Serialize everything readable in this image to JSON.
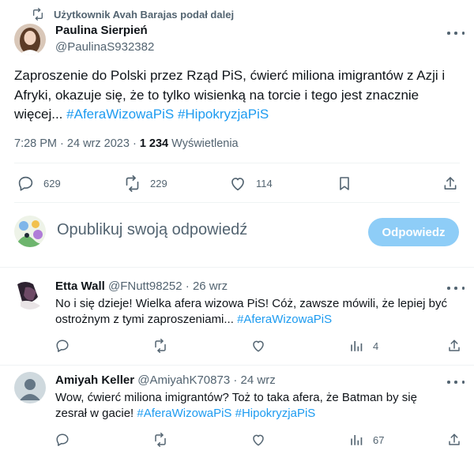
{
  "repost": {
    "text": "Użytkownik Avah Barajas podał dalej",
    "icon": "repost-icon"
  },
  "tweet": {
    "author_name": "Paulina Sierpień",
    "author_handle": "@PaulinaS932382",
    "text": "Zaproszenie do Polski przez Rząd PiS, ćwierć miliona imigrantów z Azji i Afryki, okazuje się, że to tylko wisienką na torcie i tego jest znacznie więcej...",
    "hashtags": [
      "#AferaWizowaPiS",
      "#HipokryzjaPiS"
    ],
    "time": "7:28 PM",
    "separator": "·",
    "date": "24 wrz 2023",
    "views_count": "1 234",
    "views_label": "Wyświetlenia",
    "actions": {
      "replies": "629",
      "reposts": "229",
      "likes": "114"
    }
  },
  "composer": {
    "placeholder": "Opublikuj swoją odpowiedź",
    "button_label": "Odpowiedz"
  },
  "replies": [
    {
      "name": "Etta Wall",
      "handle": "@FNutt98252",
      "separator": "·",
      "date": "26 wrz",
      "text": "No i się dzieje! Wielka afera wizowa PiS! Cóż, zawsze mówili, że lepiej być ostrożnym z tymi zaproszeniami...",
      "hashtags": [
        "#AferaWizowaPiS"
      ],
      "views": "4"
    },
    {
      "name": "Amiyah Keller",
      "handle": "@AmiyahK70873",
      "separator": "·",
      "date": "24 wrz",
      "text": "Wow, ćwierć miliona imigrantów? Toż to taka afera, że Batman by się zesrał w gacie!",
      "hashtags": [
        "#AferaWizowaPiS",
        "#HipokryzjaPiS"
      ],
      "views": "67"
    }
  ],
  "colors": {
    "accent": "#1d9bf0",
    "muted": "#536471",
    "text": "#0f1419",
    "divider": "#eff3f4",
    "button_disabled": "#8ecdf7"
  }
}
